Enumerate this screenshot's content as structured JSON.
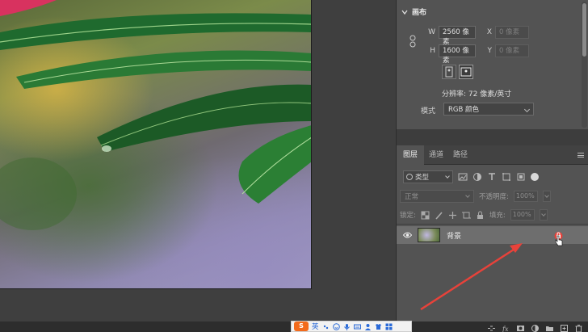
{
  "properties": {
    "section_title": "画布",
    "width_label": "W",
    "width_value": "2560 像素",
    "height_label": "H",
    "height_value": "1600 像素",
    "x_label": "X",
    "x_placeholder": "0 像素",
    "y_label": "Y",
    "y_placeholder": "0 像素",
    "resolution": "分辨率: 72 像素/英寸",
    "mode_label": "模式",
    "mode_value": "RGB 颜色"
  },
  "layers_panel": {
    "tabs": [
      "图层",
      "通道",
      "路径"
    ],
    "active_tab": 0,
    "filter_kind": "类型",
    "blend_mode": "正常",
    "opacity_label": "不透明度:",
    "opacity_value": "100%",
    "lock_label": "锁定:",
    "fill_label": "填充:",
    "fill_value": "100%",
    "layers": [
      {
        "name": "背景",
        "visible": true,
        "locked": true
      }
    ]
  },
  "ime": {
    "logo": "S",
    "lang": "英"
  },
  "colors": {
    "panel_bg": "#535353",
    "canvas_bg": "#3f3f3f",
    "selected_layer": "#6e6e6e",
    "arrow": "#e8423a"
  }
}
